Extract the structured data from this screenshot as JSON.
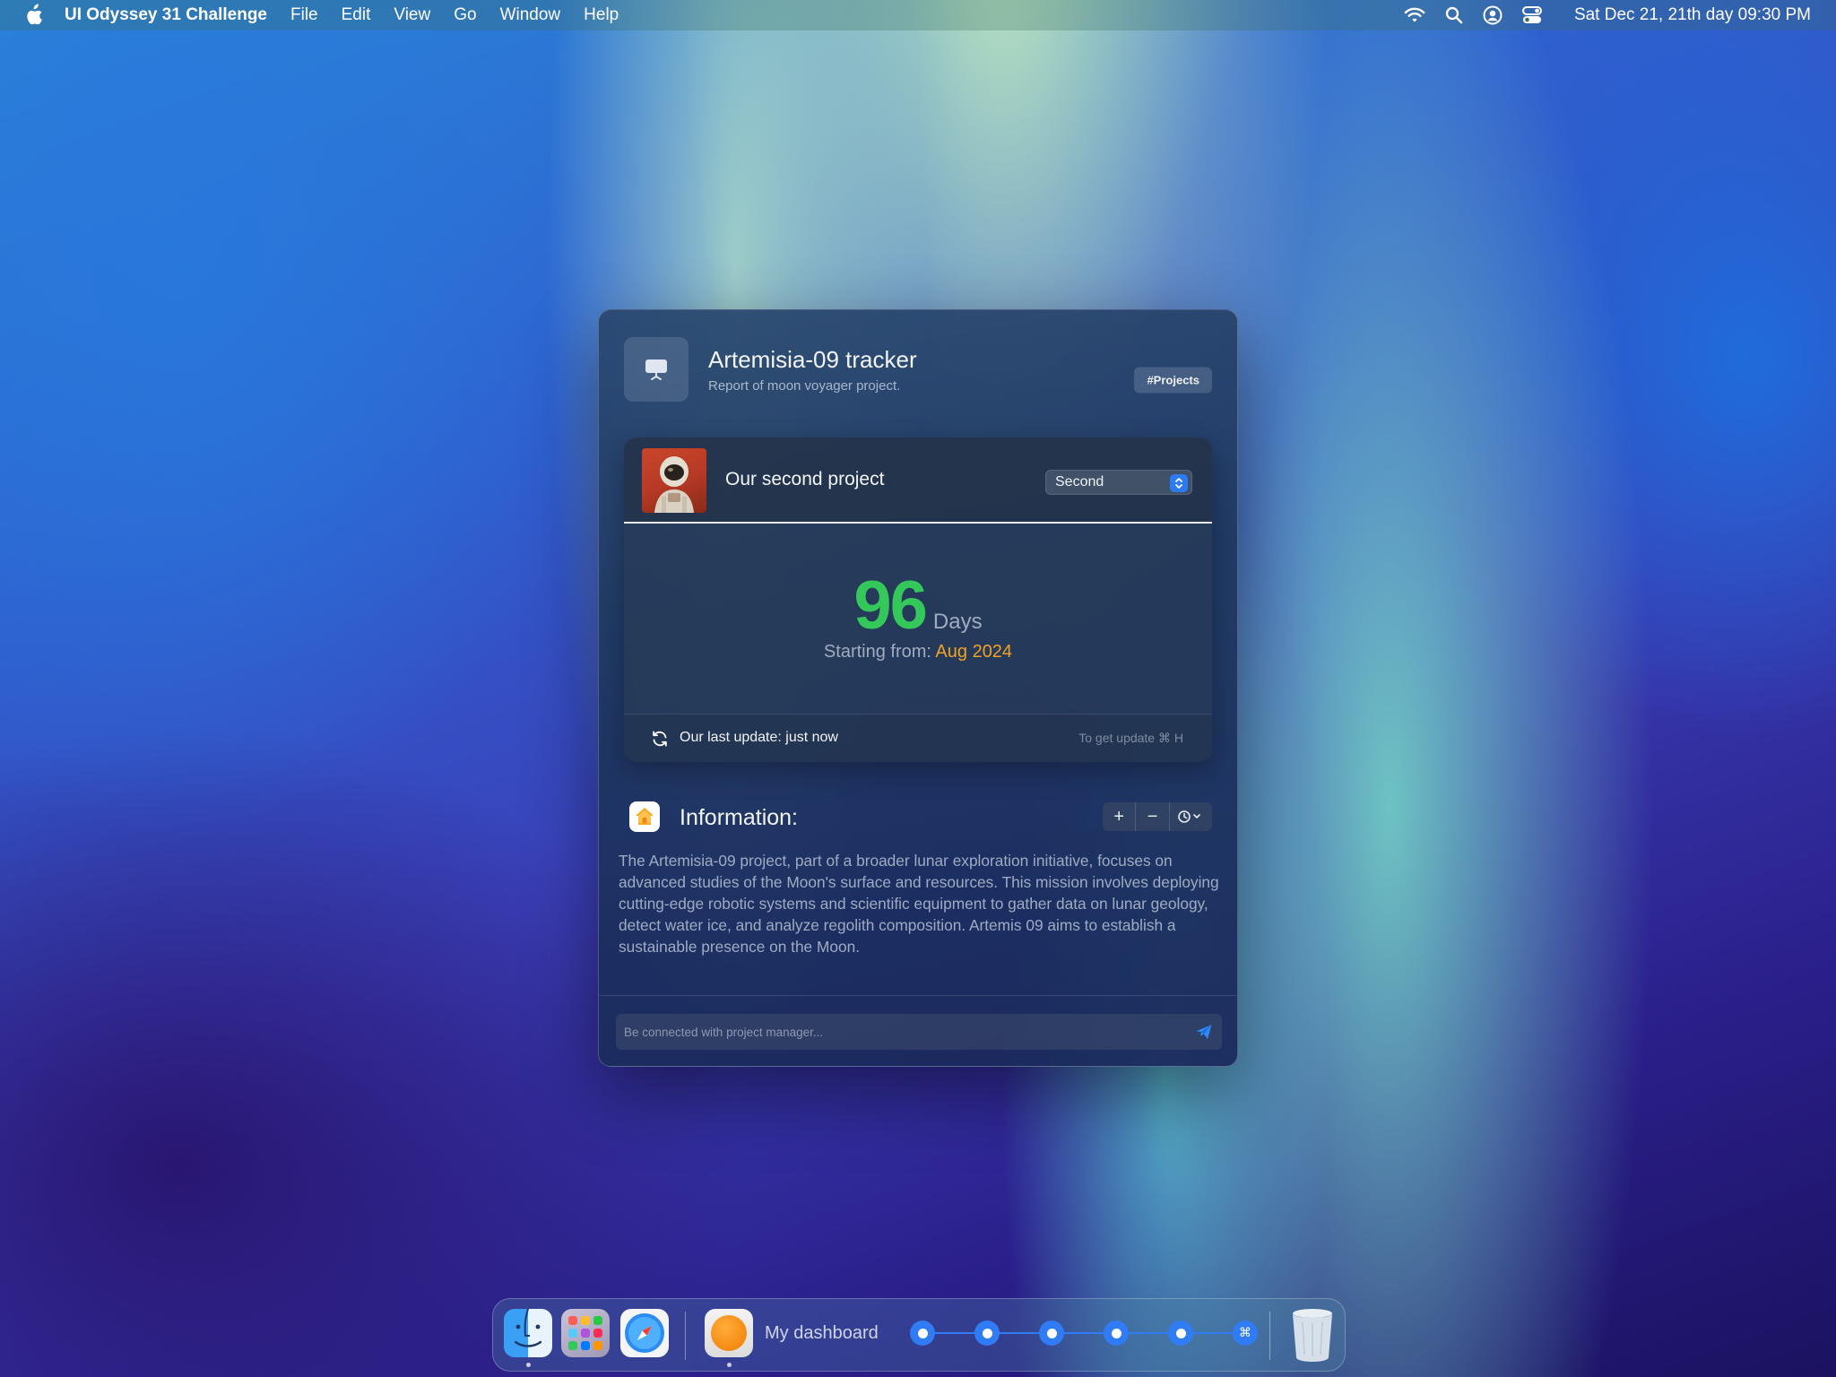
{
  "menubar": {
    "app_name": "UI Odyssey 31 Challenge",
    "menus": [
      "File",
      "Edit",
      "View",
      "Go",
      "Window",
      "Help"
    ],
    "clock": "Sat Dec 21, 21th day  09:30 PM",
    "icons": [
      "apple-logo",
      "wifi-icon",
      "search-icon",
      "user-icon",
      "control-center-icon"
    ]
  },
  "window": {
    "title": "Artemisia-09 tracker",
    "subtitle": "Report of moon voyager project.",
    "tag": "#Projects",
    "card": {
      "project_name": "Our second project",
      "select_value": "Second",
      "counter_value": "96",
      "counter_unit": "Days",
      "start_label": "Starting from:",
      "start_date": "Aug 2024",
      "last_update": "Our last update: just now",
      "hint": "To get update  ⌘ H"
    },
    "info": {
      "title": "Information:",
      "controls": [
        "+",
        "−",
        "⏲︎⌄"
      ],
      "text": "The Artemisia-09 project, part of a broader lunar exploration initiative, focuses on advanced studies of the Moon's surface and resources. This mission involves deploying cutting-edge robotic systems and scientific equipment to gather data on lunar geology, detect water ice, and analyze regolith composition. Artemis 09 aims to establish a sustainable presence on the Moon."
    },
    "message": {
      "placeholder": "Be connected with project manager..."
    }
  },
  "dock": {
    "apps": [
      "Finder",
      "Launchpad",
      "Safari"
    ],
    "label": "My dashboard",
    "steps_count": 6,
    "last_step_symbol": "⌘",
    "colors": {
      "accent": "#2f7cf6",
      "green": "#34c759",
      "orange": "#f0a223"
    }
  }
}
